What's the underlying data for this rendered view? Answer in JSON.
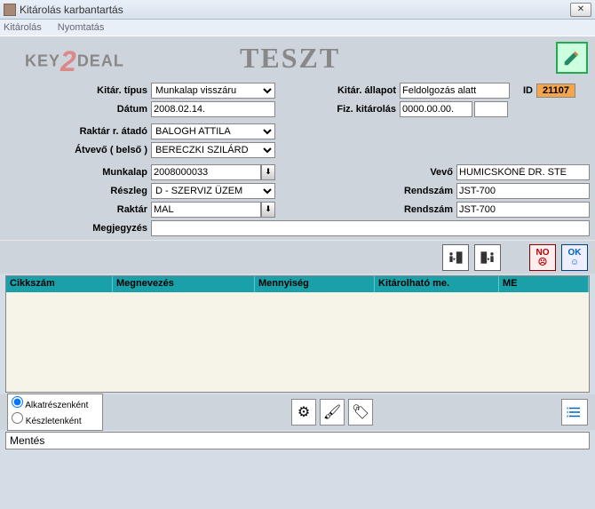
{
  "window": {
    "title": "Kitárolás karbantartás",
    "close_x": "✕"
  },
  "menu": {
    "item1": "Kitárolás",
    "item2": "Nyomtatás"
  },
  "logo": {
    "key": "KEY",
    "two": "2",
    "deal": "DEAL",
    "teszt": "TESZT"
  },
  "labels": {
    "kitar_tipus": "Kitár. típus",
    "datum": "Dátum",
    "kitar_allapot": "Kitár. állapot",
    "fiz_kitarolas": "Fiz. kitárolás",
    "id": "ID",
    "raktar_atado": "Raktár r. átadó",
    "atvevo_belso": "Átvevő ( belső )",
    "munkalap": "Munkalap",
    "reszleg": "Részleg",
    "raktar": "Raktár",
    "megjegyzes": "Megjegyzés",
    "vevo": "Vevő",
    "rendszam": "Rendszám",
    "rendszam2": "Rendszám"
  },
  "values": {
    "kitar_tipus": "Munkalap visszáru",
    "datum": "2008.02.14.",
    "kitar_allapot": "Feldolgozás alatt",
    "fiz_kitarolas": "0000.00.00.",
    "id": "21107",
    "raktar_atado": "BALOGH ATTILA",
    "atvevo_belso": "BERECZKI SZILÁRD",
    "munkalap": "2008000033",
    "reszleg": "D - SZERVIZ ÜZEM",
    "raktar": "MAL",
    "megjegyzes": "",
    "vevo": "HUMICSKÓNÉ DR. STE",
    "rendszam": "JST-700",
    "rendszam2": "JST-700"
  },
  "grid": {
    "cols": {
      "cikkszam": "Cikkszám",
      "megnevezes": "Megnevezés",
      "mennyiseg": "Mennyiség",
      "kitarolhato_me": "Kitárolható me.",
      "me": "ME"
    }
  },
  "radio": {
    "opt1": "Alkatrészenként",
    "opt2": "Készletenként"
  },
  "buttons": {
    "no": "NO",
    "ok": "OK"
  },
  "status": "Mentés"
}
